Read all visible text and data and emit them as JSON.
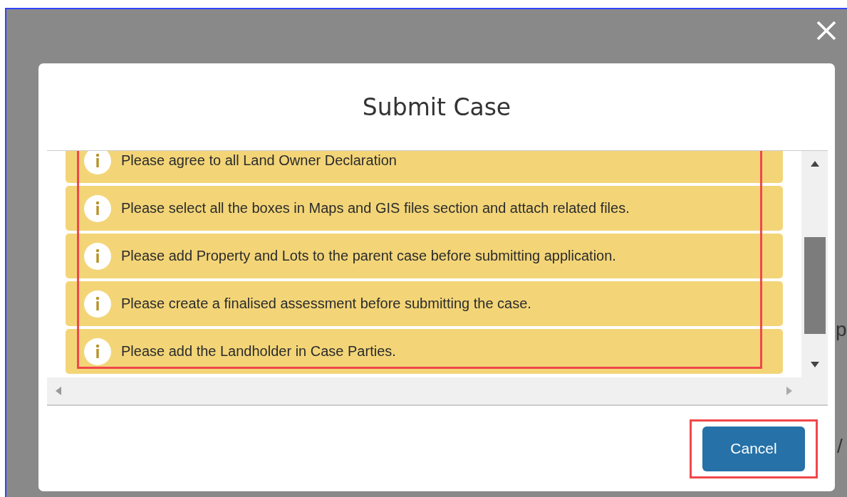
{
  "background": {
    "texts": [
      "p",
      "/"
    ]
  },
  "dialog": {
    "title": "Submit Case",
    "messages": [
      {
        "kind": "info",
        "text": "Please agree to all Land Owner Declaration"
      },
      {
        "kind": "info",
        "text": "Please select all the boxes in Maps and GIS files section and attach related files."
      },
      {
        "kind": "info",
        "text": "Please add Property and Lots to the parent case before submitting application."
      },
      {
        "kind": "info",
        "text": "Please create a finalised assessment before submitting the case."
      },
      {
        "kind": "info",
        "text": "Please add the Landholder in Case Parties."
      }
    ],
    "buttons": [
      {
        "label": "Cancel",
        "highlighted": true
      }
    ],
    "messages_highlighted": true
  }
}
